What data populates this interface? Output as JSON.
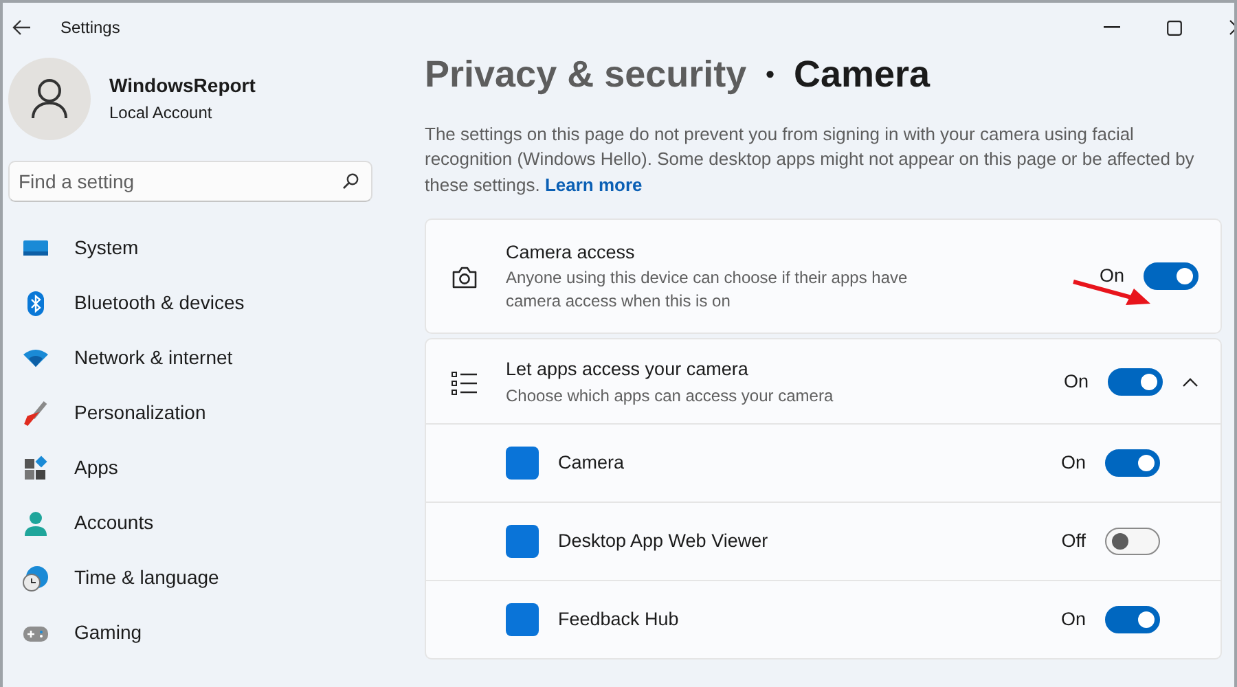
{
  "window": {
    "title": "Settings"
  },
  "account": {
    "name": "WindowsReport",
    "type": "Local Account"
  },
  "search": {
    "placeholder": "Find a setting"
  },
  "sidebar": {
    "items": [
      {
        "label": "System"
      },
      {
        "label": "Bluetooth & devices"
      },
      {
        "label": "Network & internet"
      },
      {
        "label": "Personalization"
      },
      {
        "label": "Apps"
      },
      {
        "label": "Accounts"
      },
      {
        "label": "Time & language"
      },
      {
        "label": "Gaming"
      }
    ]
  },
  "breadcrumb": {
    "parent": "Privacy & security",
    "separator": "•",
    "current": "Camera"
  },
  "description": {
    "text": "The settings on this page do not prevent you from signing in with your camera using facial recognition (Windows Hello). Some desktop apps might not appear on this page or be affected by these settings.",
    "link": "Learn more"
  },
  "settings": [
    {
      "title": "Camera access",
      "description": "Anyone using this device can choose if their apps have camera access when this is on",
      "state_label": "On",
      "on": true,
      "annotated": true
    },
    {
      "title": "Let apps access your camera",
      "description": "Choose which apps can access your camera",
      "state_label": "On",
      "on": true,
      "expanded": true
    }
  ],
  "apps": [
    {
      "name": "Camera",
      "state_label": "On",
      "on": true
    },
    {
      "name": "Desktop App Web Viewer",
      "state_label": "Off",
      "on": false
    },
    {
      "name": "Feedback Hub",
      "state_label": "On",
      "on": true
    }
  ]
}
